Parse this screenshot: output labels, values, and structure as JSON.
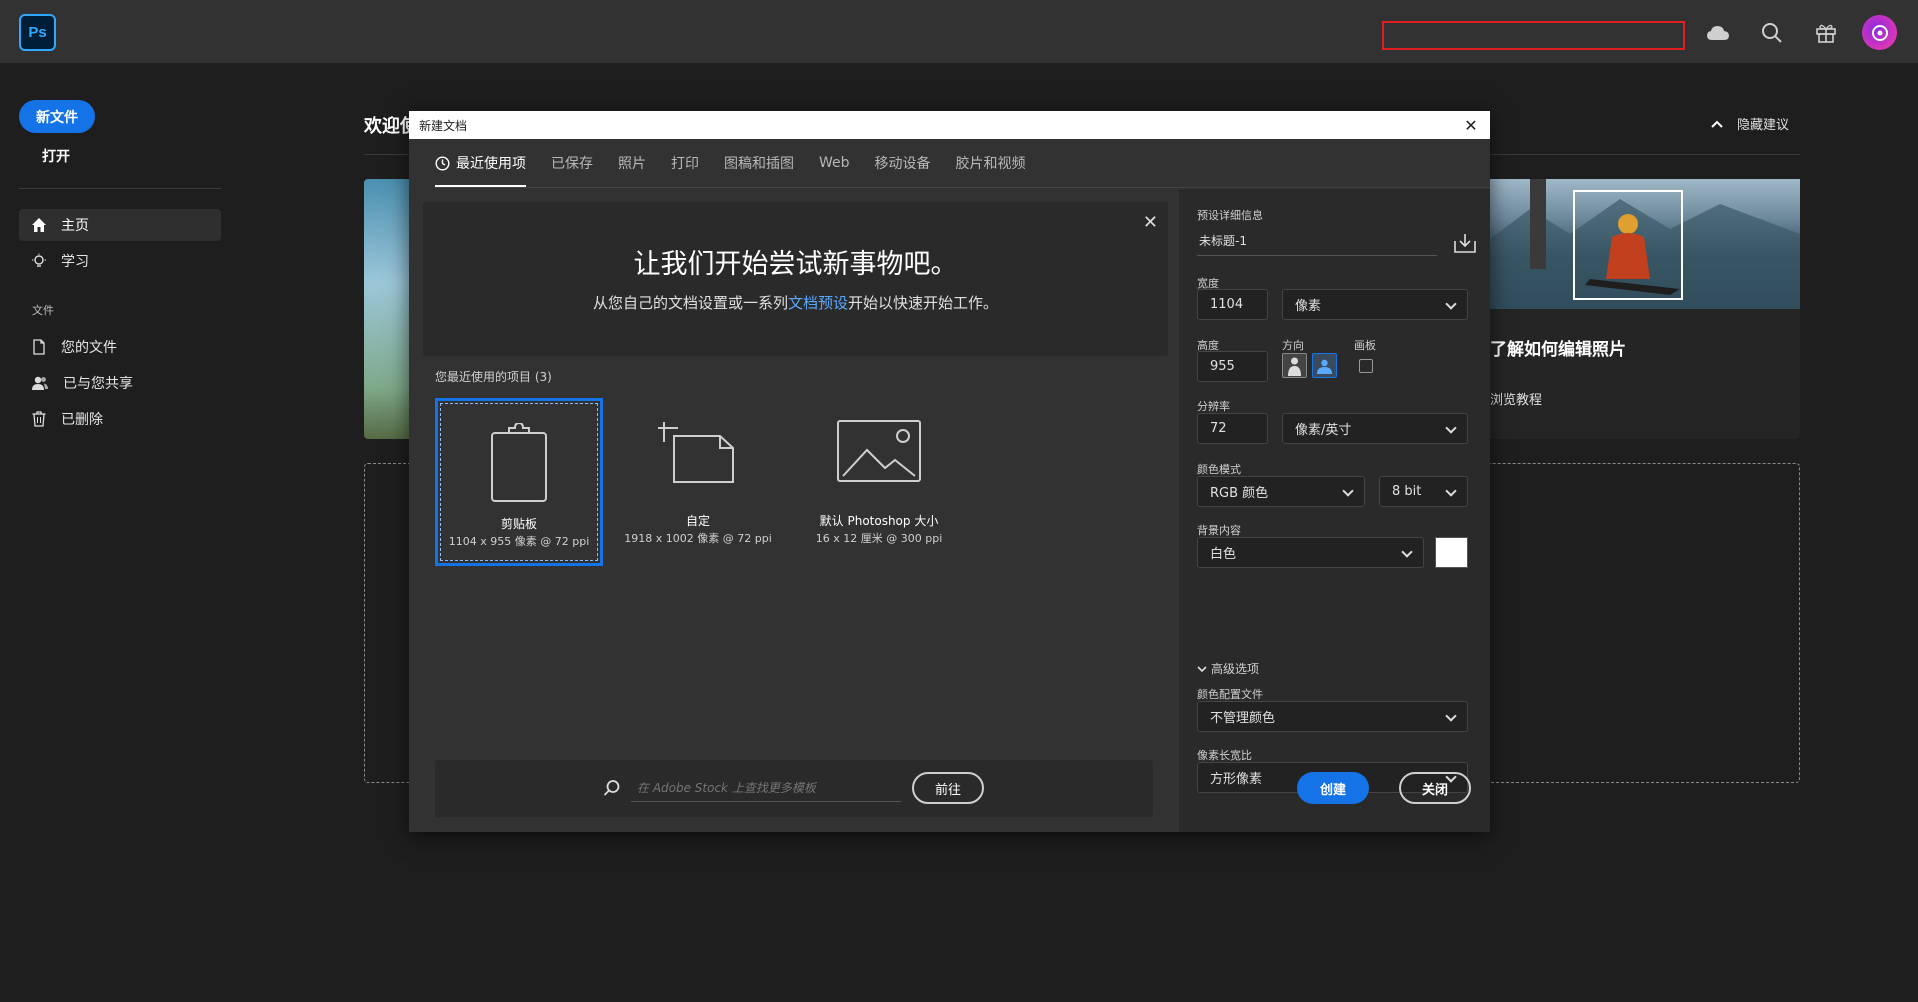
{
  "app": {
    "logo_text": "Ps"
  },
  "sidebar": {
    "new_file": "新文件",
    "open": "打开",
    "items": [
      {
        "label": "主页"
      },
      {
        "label": "学习"
      }
    ],
    "section_files": "文件",
    "file_items": [
      {
        "label": "您的文件"
      },
      {
        "label": "已与您共享"
      },
      {
        "label": "已删除"
      }
    ]
  },
  "main": {
    "welcome": "欢迎使",
    "hide_suggestions": "隐藏建议",
    "card_title": "了解如何编辑照片",
    "card_sub": "浏览教程"
  },
  "dialog": {
    "title": "新建文档",
    "tabs": [
      {
        "label": "最近使用项"
      },
      {
        "label": "已保存"
      },
      {
        "label": "照片"
      },
      {
        "label": "打印"
      },
      {
        "label": "图稿和插图"
      },
      {
        "label": "Web"
      },
      {
        "label": "移动设备"
      },
      {
        "label": "胶片和视频"
      }
    ],
    "banner_title": "让我们开始尝试新事物吧。",
    "banner_sub_before": "从您自己的文档设置或一系列",
    "banner_sub_link": "文档预设",
    "banner_sub_after": "开始以快速开始工作。",
    "recent_label": "您最近使用的项目 (3)",
    "presets": [
      {
        "name": "剪贴板",
        "spec": "1104 x 955 像素 @ 72 ppi"
      },
      {
        "name": "自定",
        "spec": "1918 x 1002 像素 @ 72 ppi"
      },
      {
        "name": "默认 Photoshop 大小",
        "spec": "16 x 12 厘米 @ 300 ppi"
      }
    ],
    "search_placeholder": "在 Adobe Stock 上查找更多模板",
    "goto": "前往",
    "details": {
      "header": "预设详细信息",
      "doc_name": "未标题-1",
      "width_label": "宽度",
      "width_value": "1104",
      "width_unit": "像素",
      "height_label": "高度",
      "height_value": "955",
      "orientation_label": "方向",
      "artboard_label": "画板",
      "resolution_label": "分辨率",
      "resolution_value": "72",
      "resolution_unit": "像素/英寸",
      "color_mode_label": "颜色模式",
      "color_mode": "RGB 颜色",
      "bit_depth": "8 bit",
      "background_label": "背景内容",
      "background": "白色",
      "advanced": "高级选项",
      "color_profile_label": "颜色配置文件",
      "color_profile": "不管理颜色",
      "pixel_aspect_label": "像素长宽比",
      "pixel_aspect": "方形像素"
    },
    "create": "创建",
    "close": "关闭"
  },
  "colors": {
    "accent": "#1473e6",
    "highlight_box": "#e02020",
    "link": "#5aa9ff"
  }
}
